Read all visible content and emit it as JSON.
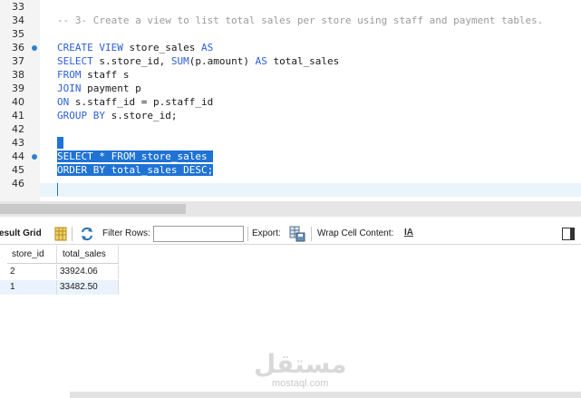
{
  "editor": {
    "lines": [
      {
        "num": "33",
        "marker": false,
        "parts": []
      },
      {
        "num": "34",
        "marker": false,
        "parts": [
          {
            "t": "-- 3- Create a view to list total sales per store using staff and payment tables.",
            "c": "cm"
          }
        ]
      },
      {
        "num": "35",
        "marker": false,
        "parts": []
      },
      {
        "num": "36",
        "marker": true,
        "parts": [
          {
            "t": "CREATE VIEW",
            "c": "kw"
          },
          {
            "t": " store_sales ",
            "c": ""
          },
          {
            "t": "AS",
            "c": "kw"
          }
        ]
      },
      {
        "num": "37",
        "marker": false,
        "parts": [
          {
            "t": "SELECT",
            "c": "kw"
          },
          {
            "t": " s.store_id, ",
            "c": ""
          },
          {
            "t": "SUM",
            "c": "kw"
          },
          {
            "t": "(p.amount) ",
            "c": ""
          },
          {
            "t": "AS",
            "c": "kw"
          },
          {
            "t": " total_sales",
            "c": ""
          }
        ]
      },
      {
        "num": "38",
        "marker": false,
        "parts": [
          {
            "t": "FROM",
            "c": "kw"
          },
          {
            "t": " staff s",
            "c": ""
          }
        ]
      },
      {
        "num": "39",
        "marker": false,
        "parts": [
          {
            "t": "JOIN",
            "c": "kw"
          },
          {
            "t": " payment p",
            "c": ""
          }
        ]
      },
      {
        "num": "40",
        "marker": false,
        "parts": [
          {
            "t": "ON",
            "c": "kw"
          },
          {
            "t": " s.staff_id = p.staff_id",
            "c": ""
          }
        ]
      },
      {
        "num": "41",
        "marker": false,
        "parts": [
          {
            "t": "GROUP BY",
            "c": "kw"
          },
          {
            "t": " s.store_id;",
            "c": ""
          }
        ]
      },
      {
        "num": "42",
        "marker": false,
        "parts": []
      },
      {
        "num": "43",
        "marker": false,
        "parts": [
          {
            "t": " ",
            "c": "sel"
          }
        ]
      },
      {
        "num": "44",
        "marker": true,
        "parts": [
          {
            "t": "SELECT * FROM store_sales ",
            "c": "sel"
          }
        ]
      },
      {
        "num": "45",
        "marker": false,
        "parts": [
          {
            "t": "ORDER BY total_sales DESC;",
            "c": "sel"
          }
        ]
      },
      {
        "num": "46",
        "marker": false,
        "parts": []
      }
    ]
  },
  "toolbar": {
    "result_grid_label": "esult Grid",
    "filter_rows_label": "Filter Rows:",
    "filter_value": "",
    "export_label": "Export:",
    "wrap_label": "Wrap Cell Content:",
    "wrap_glyph": "IA"
  },
  "grid": {
    "columns": [
      "store_id",
      "total_sales"
    ],
    "rows": [
      [
        "2",
        "33924.06"
      ],
      [
        "1",
        "33482.50"
      ]
    ]
  },
  "watermark": {
    "logo": "مستقل",
    "sub": "mostaql.com"
  },
  "colors": {
    "keyword": "#2b5fd9",
    "comment": "#9b9b9b",
    "selection": "#1f73d4",
    "marker": "#2f7fd0"
  }
}
